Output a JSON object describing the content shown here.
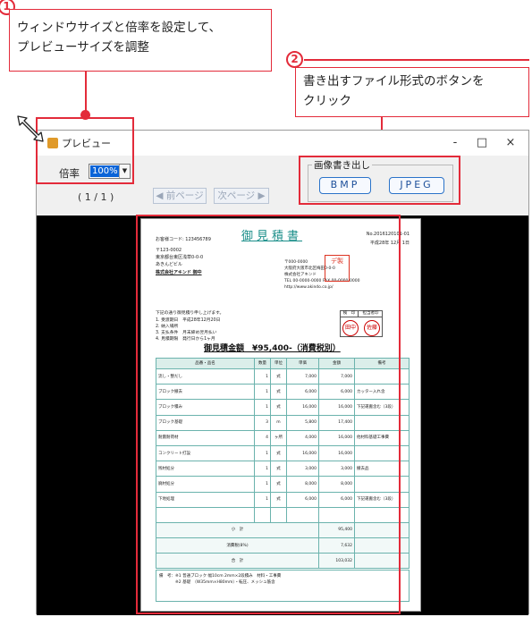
{
  "callouts": [
    {
      "number": "1",
      "line1": "ウィンドウサイズと倍率を設定して、",
      "line2": "プレビューサイズを調整"
    },
    {
      "number": "2",
      "line1": "書き出すファイル形式のボタンを",
      "line2": "クリック"
    }
  ],
  "window": {
    "title": "プレビュー",
    "controls": {
      "minimize": "-",
      "maximize": "□",
      "close": "×"
    },
    "zoom_label": "倍率",
    "zoom_value": "100%",
    "page_counter": "( 1 / 1 )",
    "prev_label": "◀ 前ページ",
    "next_label": "次ページ ▶",
    "export_group_label": "画像書き出し",
    "export_bmp": "BMP",
    "export_jpeg": "JPEG"
  },
  "document": {
    "title": "御見積書",
    "doc_no": "No.2016120101-01",
    "date": "平成28年 12月 1日",
    "customer_code": "お客様コード: 123456789",
    "address_lines": [
      "〒123-0002",
      "東京都台東区浅草0-0-0",
      "あきんどビル",
      "株式会社アキンド 御中"
    ],
    "company_lines": [
      "〒000-0000",
      "大阪府大阪市北区梅田0-0-0",
      "株式会社アキンド",
      "TEL 00-0000-0000 FAX 00-0000-0000",
      "http://www.akindo.co.jp/"
    ],
    "stamp_text": "デ製",
    "intro": "下記の通り御見積り申し上げます。",
    "conditions": [
      "1. 受渡期日　平成28年12月20日",
      "2. 納入場所",
      "3. 支払条件　月末締め翌月払い",
      "4. 見積期限　発行日から1ヶ月"
    ],
    "total": "御見積金額　¥95,400-（消費税別）",
    "approval_headers": [
      "検　印",
      "担当者印"
    ],
    "approval_seals": [
      "田中",
      "佐藤"
    ],
    "table_headers": [
      "品番・品名",
      "数量",
      "単位",
      "単価",
      "金額",
      "備考"
    ],
    "items": [
      [
        "流し・整だし",
        "1",
        "式",
        "7,000",
        "7,000",
        ""
      ],
      [
        "ブロック撤去",
        "1",
        "式",
        "6,000",
        "6,000",
        "カッター入れ含"
      ],
      [
        "ブロック積み",
        "1",
        "式",
        "16,000",
        "16,000",
        "下記運搬含む（3段）"
      ],
      [
        "ブロック基礎",
        "3",
        "m",
        "5,800",
        "17,400",
        ""
      ],
      [
        "耐震耐荷材",
        "4",
        "ヶ所",
        "4,000",
        "16,000",
        "他材料基礎工事費"
      ],
      [
        "コンクリート打設",
        "1",
        "式",
        "16,000",
        "16,000",
        ""
      ],
      [
        "残材処分",
        "1",
        "式",
        "3,000",
        "3,000",
        "撤去品"
      ],
      [
        "廃材処分",
        "1",
        "式",
        "8,000",
        "8,000",
        ""
      ],
      [
        "下地処理",
        "1",
        "式",
        "6,000",
        "6,000",
        "下記運搬含む（3段）"
      ],
      [
        "",
        "",
        "",
        "",
        "",
        ""
      ]
    ],
    "subtotal_label": "小　計",
    "subtotal": "95,400",
    "tax_label": "消費税(8%)",
    "tax": "7,632",
    "grand_label": "合　計",
    "grand": "103,032",
    "notes": [
      "備　考：※1 普通ブロック 幅10cm 2mm×2段積み　材料・工事費",
      "　　　　※2 基礎　（W35mm×H80mm）・転圧、メッシュ筋含"
    ]
  }
}
